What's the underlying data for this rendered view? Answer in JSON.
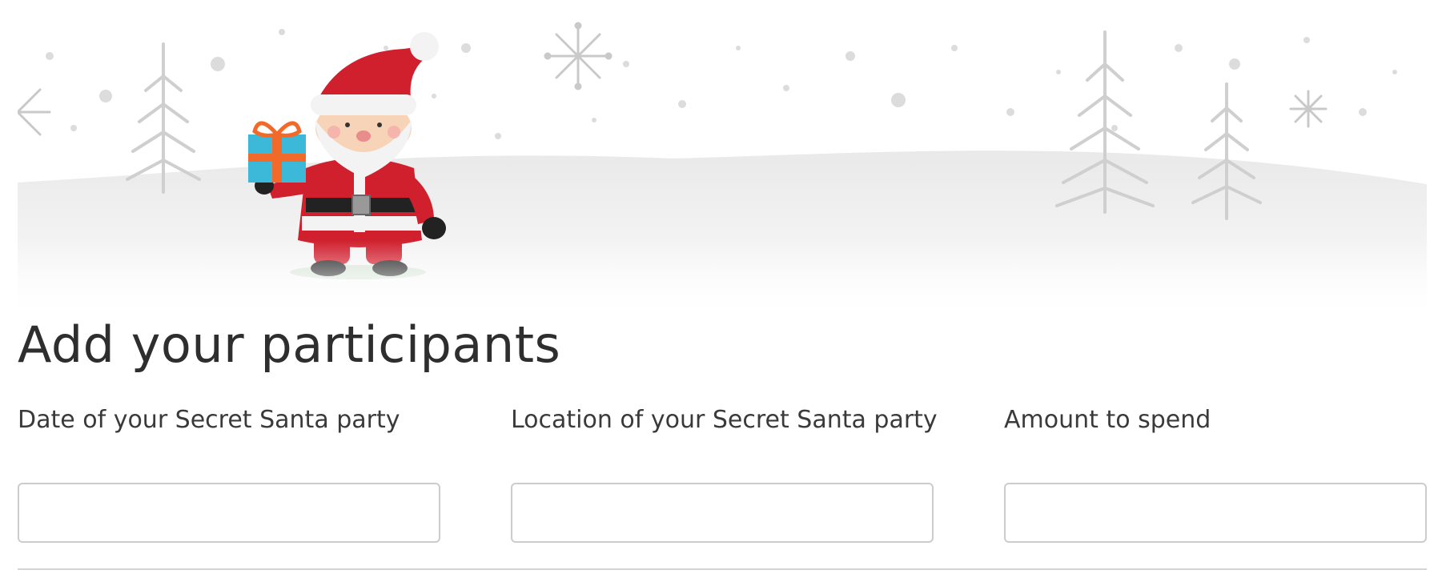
{
  "banner": {
    "santa_icon": "santa-claus-with-gift",
    "theme": "snowy-winter-landscape",
    "colors": {
      "sky": "#ffffff",
      "snow_hill": "#ececec",
      "trees": "#d3d3d3",
      "santa_red": "#d0202e",
      "gift_blue": "#3cb8d8",
      "ribbon_orange": "#f26a2a"
    }
  },
  "page": {
    "title": "Add your participants"
  },
  "form": {
    "fields": [
      {
        "label": "Date of your Secret Santa party",
        "value": "",
        "placeholder": ""
      },
      {
        "label": "Location of your Secret Santa party",
        "value": "",
        "placeholder": ""
      },
      {
        "label": "Amount to spend",
        "value": "",
        "placeholder": ""
      }
    ]
  }
}
